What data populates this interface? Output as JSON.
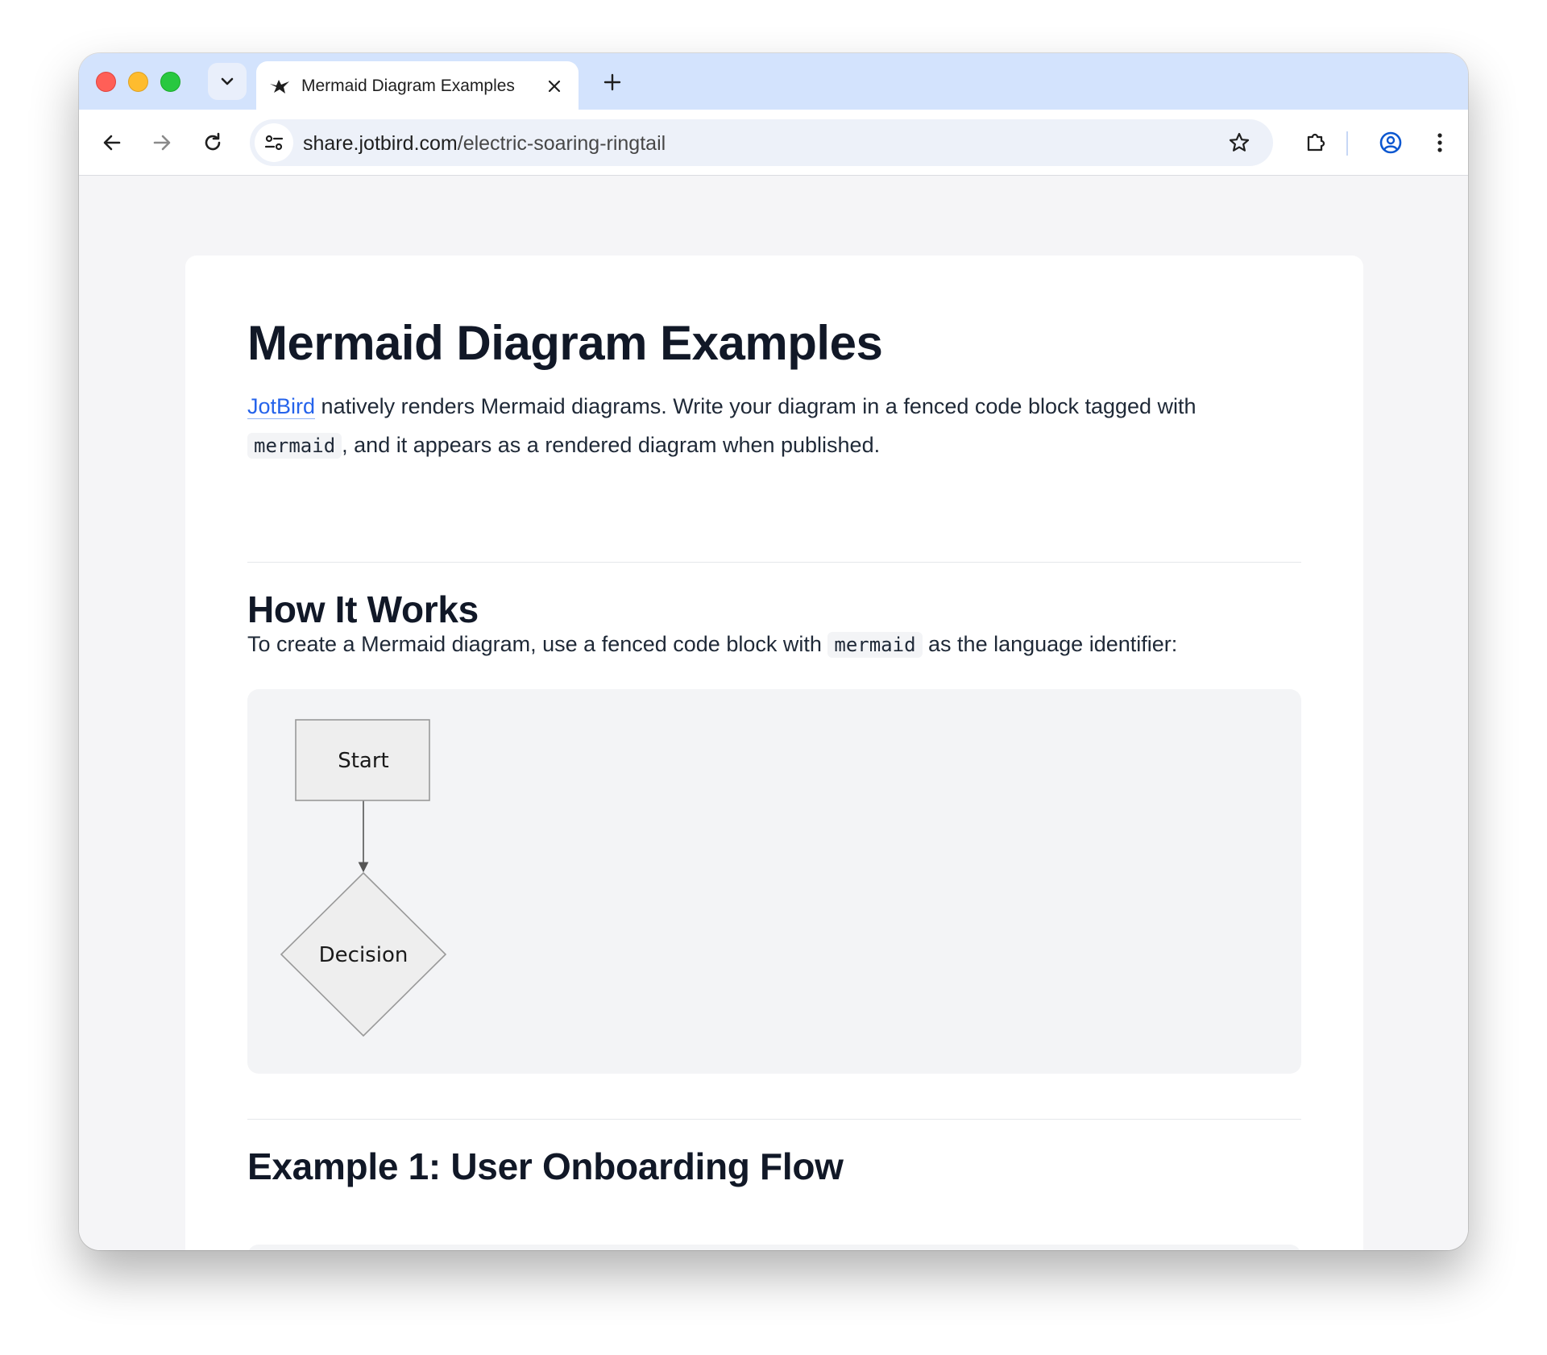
{
  "browser": {
    "tab": {
      "title": "Mermaid Diagram Examples"
    },
    "address_bar": {
      "domain": "share.jotbird.com",
      "path": "/electric-soaring-ringtail"
    }
  },
  "article": {
    "title": "Mermaid Diagram Examples",
    "intro": {
      "link_text": "JotBird",
      "text_1": " natively renders Mermaid diagrams. Write your diagram in a fenced code block tagged with ",
      "code": "mermaid",
      "text_2": ", and it appears as a rendered diagram when published."
    },
    "section_how": {
      "heading": "How It Works",
      "text_1": "To create a Mermaid diagram, use a fenced code block with ",
      "code": "mermaid",
      "text_2": " as the language identifier:"
    },
    "diagram": {
      "nodes": [
        {
          "id": "start",
          "label": "Start",
          "shape": "rect"
        },
        {
          "id": "decision",
          "label": "Decision",
          "shape": "diamond"
        }
      ],
      "edges": [
        {
          "from": "start",
          "to": "decision"
        }
      ],
      "colors": {
        "fill": "#eeeeee",
        "stroke": "#999999",
        "edge": "#555555",
        "text": "#1a1a1a"
      }
    },
    "section_example1": {
      "heading": "Example 1: User Onboarding Flow"
    }
  },
  "colors": {
    "link": "#2563eb",
    "heading": "#111827",
    "body_text": "#1f2937"
  }
}
